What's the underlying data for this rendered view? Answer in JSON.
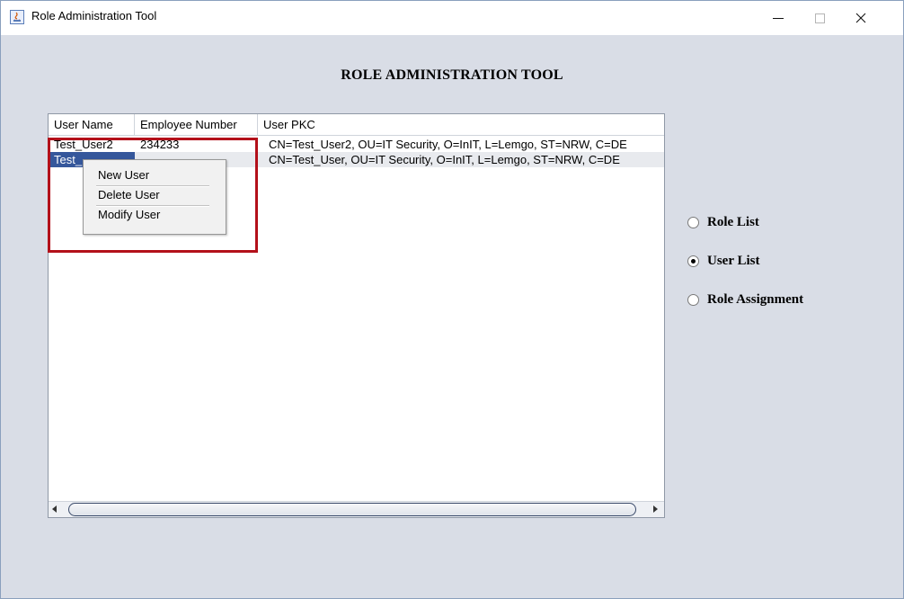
{
  "window": {
    "title": "Role Administration Tool"
  },
  "heading": "ROLE ADMINISTRATION TOOL",
  "table": {
    "columns": [
      "User Name",
      "Employee Number",
      "User PKC"
    ],
    "rows": [
      {
        "user_name": "Test_User2",
        "employee_number": "234233",
        "user_pkc": "CN=Test_User2, OU=IT Security, O=InIT, L=Lemgo, ST=NRW, C=DE"
      },
      {
        "user_name": "Test_",
        "employee_number": "",
        "user_pkc": "CN=Test_User, OU=IT Security, O=InIT, L=Lemgo, ST=NRW, C=DE"
      }
    ]
  },
  "context_menu": {
    "items": [
      "New User",
      "Delete User",
      "Modify User"
    ]
  },
  "radios": [
    {
      "label": "Role List",
      "checked": false
    },
    {
      "label": "User List",
      "checked": true
    },
    {
      "label": "Role Assignment",
      "checked": false
    }
  ],
  "colors": {
    "background": "#d9dde6",
    "selection": "#35579b",
    "highlight_border": "#b3101a"
  }
}
